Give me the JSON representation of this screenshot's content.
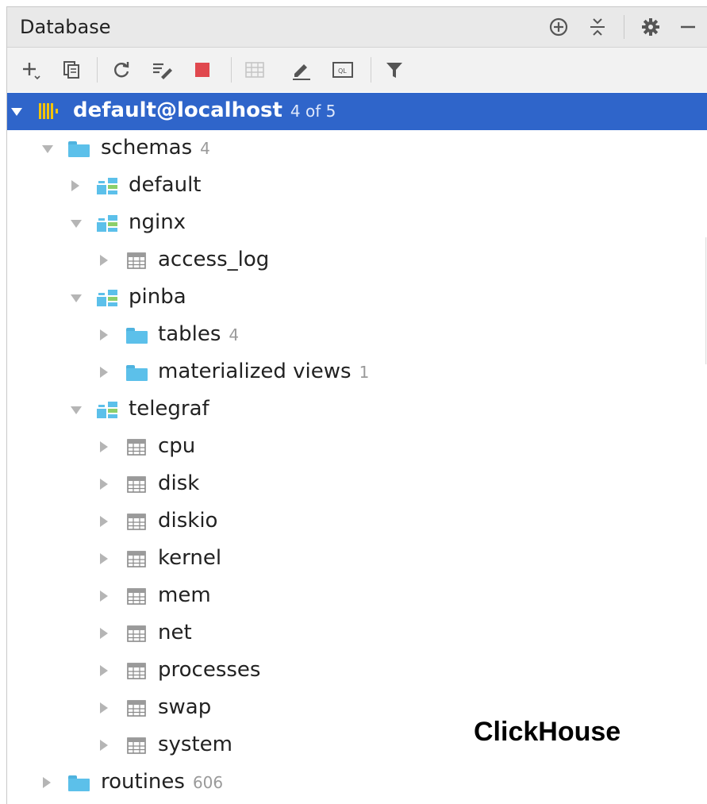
{
  "panel": {
    "title": "Database",
    "header_icons": [
      "crosshair-icon",
      "collapse-all-icon",
      "gear-icon",
      "minimize-icon"
    ]
  },
  "toolbar": {
    "buttons": [
      "add-icon",
      "duplicate-icon",
      "refresh-icon",
      "schema-edit-icon",
      "stop-icon",
      "table-view-icon",
      "edit-icon",
      "sql-console-icon",
      "filter-icon"
    ],
    "sql_console_label": "QL"
  },
  "tree": {
    "connection": {
      "label": "default@localhost",
      "count": "4 of 5"
    },
    "schemas": {
      "label": "schemas",
      "count": "4"
    },
    "schema_default": {
      "label": "default"
    },
    "schema_nginx": {
      "label": "nginx"
    },
    "table_access_log": {
      "label": "access_log"
    },
    "schema_pinba": {
      "label": "pinba"
    },
    "folder_tables": {
      "label": "tables",
      "count": "4"
    },
    "folder_mviews": {
      "label": "materialized views",
      "count": "1"
    },
    "schema_telegraf": {
      "label": "telegraf"
    },
    "telegraf_tables": [
      "cpu",
      "disk",
      "diskio",
      "kernel",
      "mem",
      "net",
      "processes",
      "swap",
      "system"
    ],
    "routines": {
      "label": "routines",
      "count": "606"
    }
  },
  "brand_text": "ClickHouse",
  "colors": {
    "selection": "#2f65ca",
    "folder": "#5cc0ea",
    "stop": "#e0484e",
    "clickhouse_yellow": "#f5c400"
  }
}
